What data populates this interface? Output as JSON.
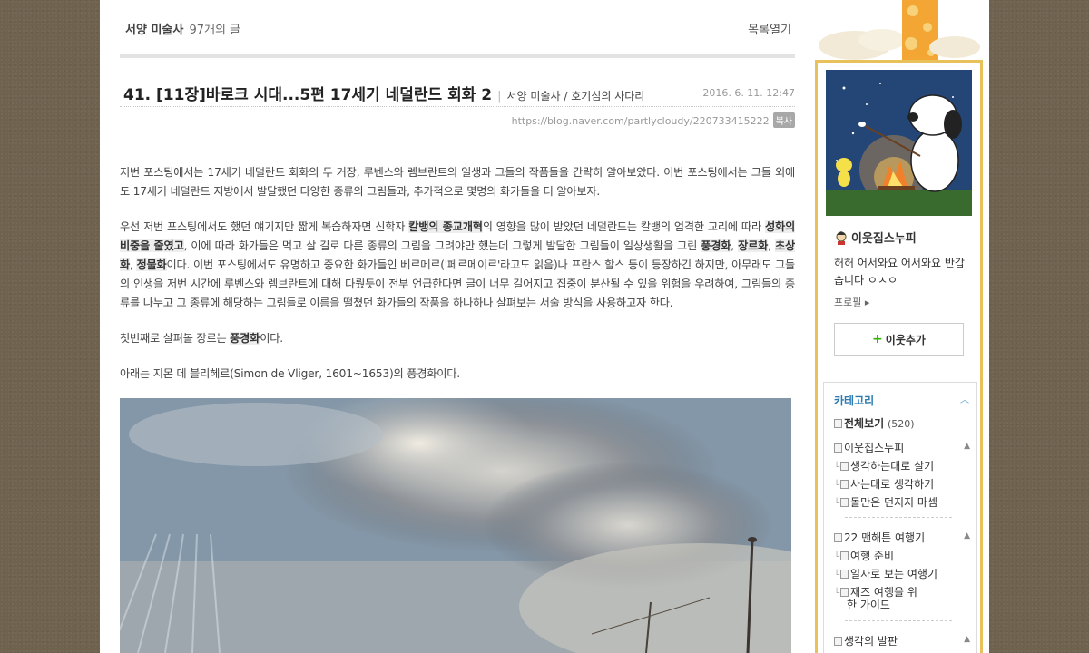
{
  "topbar": {
    "category": "서양 미술사",
    "count": "97개의 글",
    "list_open": "목록열기"
  },
  "post": {
    "title": "41. [11장]바로크 시대...5편 17세기 네덜란드 회화 2",
    "category": "서양 미술사 / 호기심의 사다리",
    "date": "2016. 6. 11. 12:47",
    "url": "https://blog.naver.com/partlycloudy/220733415222",
    "copy": "복사",
    "p1": "저번 포스팅에서는 17세기 네덜란드 회화의 두 거장, 루벤스와 렘브란트의 일생과 그들의 작품들을 간략히 알아보았다. 이번 포스팅에서는 그들 외에도 17세기 네덜란드 지방에서 발달했던 다양한 종류의 그림들과, 추가적으로 몇명의 화가들을 더 알아보자.",
    "p2_a": "우선 저번 포스팅에서도 했던 얘기지만 짧게 복습하자면 신학자 ",
    "p2_b": "칼뱅의 종교개혁",
    "p2_c": "의 영향을 많이 받았던 네덜란드는 칼뱅의 엄격한 교리에 따라 ",
    "p2_d": "성화의 비중을 줄였고",
    "p2_e": ", 이에 따라 화가들은 먹고 살 길로 다른 종류의 그림을 그려야만 했는데 그렇게 발달한 그림들이 일상생활을 그린 ",
    "p2_f": "풍경화",
    "p2_g": ", ",
    "p2_h": "장르화",
    "p2_i": ", ",
    "p2_j": "초상화",
    "p2_k": ", ",
    "p2_l": "정물화",
    "p2_m": "이다. 이번 포스팅에서도 유명하고 중요한 화가들인 베르메르('페르메이르'라고도 읽음)나 프란스 할스 등이 등장하긴 하지만, 아무래도 그들의 인생을 저번 시간에 루벤스와 렘브란트에 대해 다뤘듯이 전부 언급한다면 글이 너무 길어지고 집중이 분산될 수 있을 위험을 우려하여, 그림들의 종류를 나누고 그 종류에 해당하는 그림들로 이름을 떨쳤던 화가들의 작품을 하나하나 살펴보는 서술 방식을 사용하고자 한다.",
    "p3_a": "첫번째로 살펴볼 장르는 ",
    "p3_b": "풍경화",
    "p3_c": "이다.",
    "p4": "아래는 지몬 데 블리헤르(Simon de Vliger, 1601~1653)의 풍경화이다."
  },
  "sidebar": {
    "nickname": "이웃집스누피",
    "intro": "허허 어서와요 어서와요 반갑습니다 ㅇㅅㅇ",
    "profile_link": "프로필",
    "add_neighbor": "이웃추가",
    "category_title": "카테고리",
    "categories": [
      {
        "label": "전체보기",
        "count": "(520)"
      },
      {
        "label": "이웃집스누피"
      },
      {
        "label": "생각하는대로 살기"
      },
      {
        "label": "사는대로 생각하기"
      },
      {
        "label": "돌만은 던지지 마셈"
      },
      {
        "label": "22 맨해튼 여행기"
      },
      {
        "label": "여행 준비"
      },
      {
        "label": "일자로 보는 여행기"
      },
      {
        "label": "재즈 여행을 위"
      },
      {
        "label": "한 가이드"
      },
      {
        "label": "생각의 발판"
      }
    ]
  },
  "colors": {
    "accent": "#e8c15a",
    "category_blue": "#2b7bb0",
    "plus_green": "#2db400",
    "bg": "#6f6350"
  }
}
